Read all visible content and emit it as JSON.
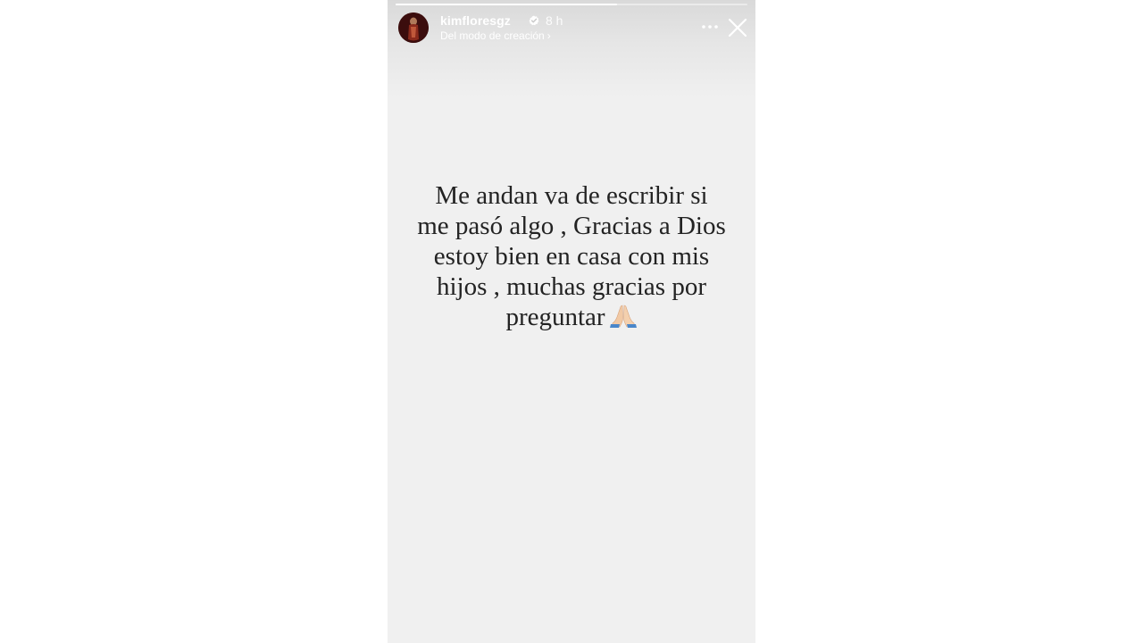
{
  "story": {
    "progress_fraction": 0.63,
    "header": {
      "username": "kimfloresgz",
      "verified": true,
      "time": "8 h",
      "subtitle": "Del modo de creación",
      "subtitle_chevron": "›",
      "more_icon": "more-dots-icon",
      "close_icon": "close-icon"
    },
    "message": {
      "lines": [
        "Me andan va de escribir si",
        "me pasó algo , Gracias a Dios",
        "estoy bien en casa con mis",
        "hijos , muchas gracias por",
        "preguntar"
      ],
      "emoji_icon": "praying-hands-icon"
    },
    "colors": {
      "background": "#f0f0f0",
      "text": "#232323",
      "verified": "#ffffff"
    }
  }
}
